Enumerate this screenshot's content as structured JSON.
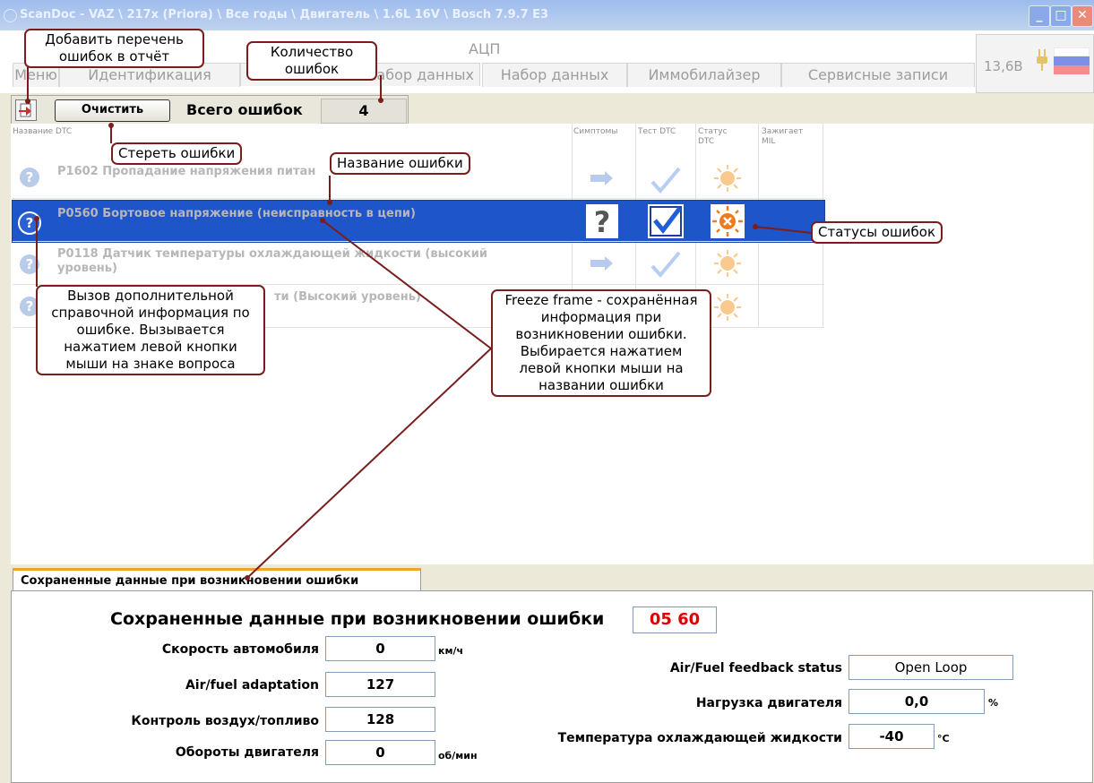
{
  "window": {
    "title": "ScanDoc - VAZ \\ 217x (Priora) \\ Все годы \\ Двигатель \\ 1.6L 16V \\ Bosch 7.9.7 E3",
    "min_symbol": "_",
    "max_symbol": "□",
    "close_symbol": "✕"
  },
  "tabs": {
    "adc": "АЦП",
    "items": [
      "Меню",
      "Идентификация",
      "Набор данных",
      "Набор данных",
      "Иммобилайзер",
      "Сервисные записи"
    ],
    "voltage": "13,6В"
  },
  "toolbar": {
    "clear_label": "Очистить",
    "total_label": "Всего ошибок",
    "total_value": "4"
  },
  "table": {
    "columns": [
      "Название DTC",
      "Симптомы",
      "Тест DTC",
      "Статус DTC",
      "Зажигает MIL"
    ],
    "rows": [
      {
        "text": "P1602 Пропадание напряжения питан"
      },
      {
        "text": "P0560 Бортовое напряжение (неисправность в цепи)"
      },
      {
        "text": "P0118 Датчик температуры охлаждающей жидкости (высокий уровень)"
      },
      {
        "text": "ти (Высокий уровень)"
      }
    ]
  },
  "callouts": {
    "add_report": "Добавить перечень ошибок в отчёт",
    "count": "Количество ошибок",
    "clear": "Стереть ошибки",
    "error_name": "Название ошибки",
    "statuses": "Статусы ошибок",
    "help": "Вызов дополнительной справочной информация по ошибке. Вызывается нажатием левой кнопки мыши на знаке вопроса",
    "freeze": "Freeze frame - сохранённая информация при возникновении ошибки. Выбирается нажатием левой кнопки мыши на названии ошибки"
  },
  "freeze": {
    "tab_label": "Сохраненные данные при возникновении ошибки",
    "heading": "Сохраненные данные при возникновении ошибки",
    "code": "05 60",
    "left_fields": [
      {
        "label": "Скорость автомобиля",
        "value": "0",
        "unit": "км/ч"
      },
      {
        "label": "Air/fuel adaptation",
        "value": "127",
        "unit": ""
      },
      {
        "label": "Контроль воздух/топливо",
        "value": "128",
        "unit": ""
      },
      {
        "label": "Обороты двигателя",
        "value": "0",
        "unit": "об/мин"
      }
    ],
    "right_fields": [
      {
        "label": "Air/Fuel  feedback status",
        "value": "Open Loop",
        "unit": ""
      },
      {
        "label": "Нагрузка двигателя",
        "value": "0,0",
        "unit": "%"
      },
      {
        "label": "Температура охлаждающей жидкости",
        "value": "-40",
        "unit": "°C"
      }
    ]
  },
  "colors": {
    "selection": "#1e55c8",
    "code_red": "#e00000",
    "callout_border": "#7a1d1d"
  }
}
